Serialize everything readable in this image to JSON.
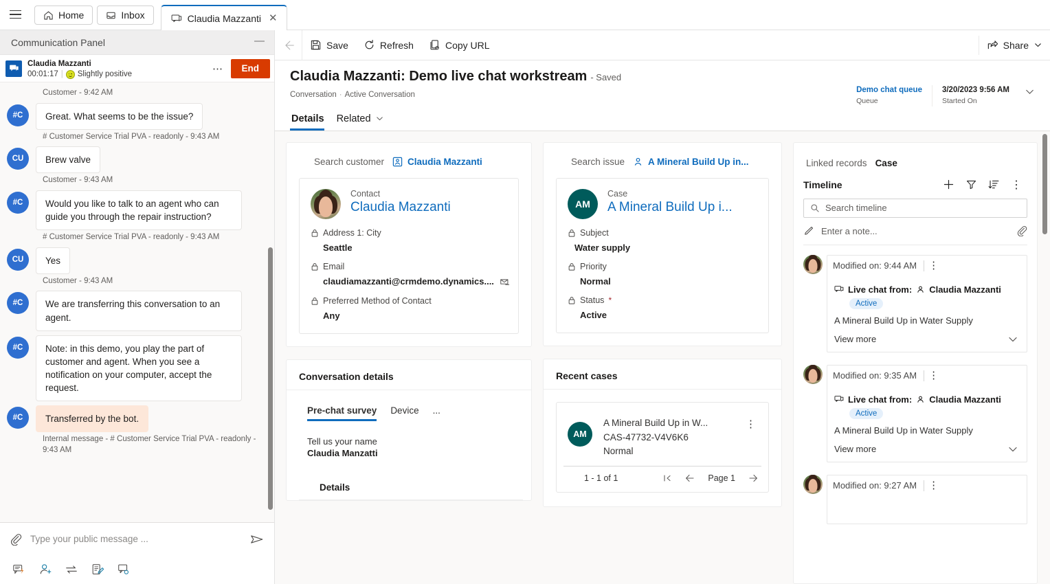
{
  "tabbar": {
    "home_label": "Home",
    "inbox_label": "Inbox",
    "active_tab_label": "Claudia Mazzanti"
  },
  "comm_panel": {
    "title": "Communication Panel",
    "session": {
      "name": "Claudia Mazzanti",
      "timer": "00:01:17",
      "divider": "|",
      "sentiment": "Slightly positive",
      "end_label": "End"
    },
    "messages": [
      {
        "meta_above": "Customer - 9:42 AM",
        "avatar": "#C",
        "text": "Great. What seems to be the issue?",
        "meta": "# Customer Service Trial PVA - readonly - 9:43 AM",
        "style": "normal"
      },
      {
        "avatar": "CU",
        "text": "Brew valve",
        "meta": "Customer - 9:43 AM",
        "style": "normal"
      },
      {
        "avatar": "#C",
        "text": "Would you like to talk to an agent who can guide you through the repair instruction?",
        "meta": "# Customer Service Trial PVA - readonly - 9:43 AM",
        "style": "normal"
      },
      {
        "avatar": "CU",
        "text": "Yes",
        "meta": "Customer - 9:43 AM",
        "style": "normal"
      },
      {
        "avatar": "#C",
        "text": "We are transferring this conversation to an agent.",
        "meta": "",
        "style": "normal"
      },
      {
        "avatar": "#C",
        "text": "Note: in this demo, you play the part of customer and agent. When you see a notification on your computer, accept the request.",
        "meta": "",
        "style": "normal"
      },
      {
        "avatar": "#C",
        "text": "Transferred by the bot.",
        "meta": "Internal message - # Customer Service Trial PVA - readonly - 9:43 AM",
        "style": "warn"
      }
    ],
    "composer_placeholder": "Type your public message ...",
    "tray_icons": [
      "quick-reply-icon",
      "add-agent-icon",
      "transfer-icon",
      "note-icon",
      "consult-icon"
    ]
  },
  "command_bar": {
    "save_label": "Save",
    "refresh_label": "Refresh",
    "copy_url_label": "Copy URL",
    "share_label": "Share"
  },
  "record_header": {
    "title": "Claudia Mazzanti: Demo live chat workstream",
    "saved_label": "- Saved",
    "breadcrumb_entity": "Conversation",
    "breadcrumb_sep": "·",
    "breadcrumb_view": "Active Conversation",
    "fields": [
      {
        "value": "Demo chat queue",
        "label": "Queue",
        "link": true
      },
      {
        "value": "3/20/2023 9:56 AM",
        "label": "Started On",
        "link": false
      }
    ]
  },
  "form_tabs": [
    {
      "label": "Details",
      "selected": true,
      "chevron": false
    },
    {
      "label": "Related",
      "selected": false,
      "chevron": true
    }
  ],
  "customer_panel": {
    "search_label": "Search customer",
    "search_value": "Claudia Mazzanti",
    "kind": "Contact",
    "name": "Claudia Mazzanti",
    "fields": [
      {
        "label": "Address 1: City",
        "value": "Seattle",
        "required": false,
        "trailing_icon": ""
      },
      {
        "label": "Email",
        "value": "claudiamazzanti@crmdemo.dynamics....",
        "required": false,
        "trailing_icon": "email-icon"
      },
      {
        "label": "Preferred Method of Contact",
        "value": "Any",
        "required": false,
        "trailing_icon": ""
      }
    ]
  },
  "issue_panel": {
    "search_label": "Search issue",
    "search_value": "A Mineral Build Up in...",
    "kind": "Case",
    "initials": "AM",
    "name": "A Mineral Build Up i...",
    "fields": [
      {
        "label": "Subject",
        "value": "Water supply",
        "required": false
      },
      {
        "label": "Priority",
        "value": "Normal",
        "required": false
      },
      {
        "label": "Status",
        "value": "Active",
        "required": true
      }
    ]
  },
  "conversation_details": {
    "title": "Conversation details",
    "tabs": [
      {
        "label": "Pre-chat survey",
        "selected": true
      },
      {
        "label": "Device",
        "selected": false
      },
      {
        "label": "...",
        "selected": false
      }
    ],
    "survey_question": "Tell us your name",
    "survey_answer": "Claudia Manzatti",
    "details_heading": "Details"
  },
  "recent_cases": {
    "title": "Recent cases",
    "rows": [
      {
        "initials": "AM",
        "title": "A Mineral Build Up in W...",
        "number": "CAS-47732-V4V6K6",
        "priority": "Normal"
      }
    ],
    "count_label": "1 - 1 of 1",
    "page_label": "Page 1"
  },
  "timeline_panel": {
    "linked_records_label": "Linked records",
    "linked_records_value": "Case",
    "title": "Timeline",
    "icons": [
      "plus-icon",
      "filter-icon",
      "sort-icon",
      "more-icon"
    ],
    "search_placeholder": "Search timeline",
    "note_placeholder": "Enter a note...",
    "items": [
      {
        "when": "Modified on: 9:44 AM",
        "channel": "Live chat from:",
        "person": "Claudia Mazzanti",
        "badge": "Active",
        "subject": "A Mineral Build Up in Water Supply",
        "more_label": "View more"
      },
      {
        "when": "Modified on: 9:35 AM",
        "channel": "Live chat from:",
        "person": "Claudia Mazzanti",
        "badge": "Active",
        "subject": "A Mineral Build Up in Water Supply",
        "more_label": "View more"
      },
      {
        "when": "Modified on: 9:27 AM",
        "channel": "",
        "person": "",
        "badge": "",
        "subject": "",
        "more_label": ""
      }
    ]
  },
  "colors": {
    "accent": "#0f6cbd",
    "end_button": "#d83b01",
    "case_avatar": "#005b5b",
    "bot_avatar": "#2f6fd0",
    "warn_bubble": "#fde7d9"
  }
}
